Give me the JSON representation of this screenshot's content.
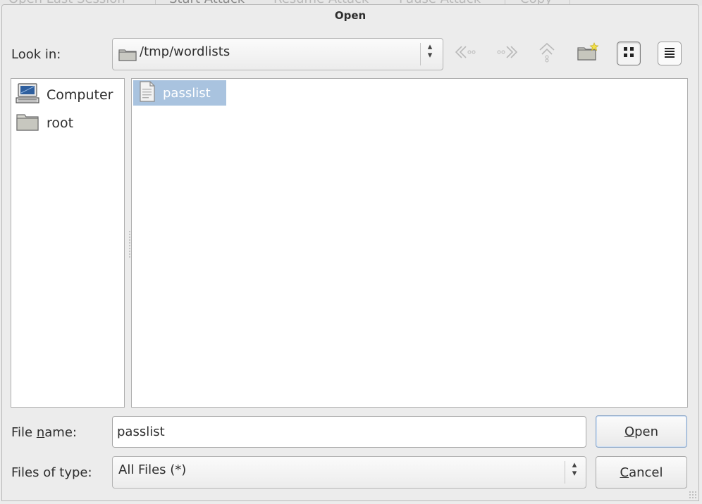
{
  "background_toolbar": {
    "items": [
      "Open Last Session",
      "Start Attack",
      "Resume Attack",
      "Pause Attack",
      "Copy"
    ]
  },
  "dialog": {
    "title": "Open",
    "look_in": {
      "label": "Look in:",
      "value": "/tmp/wordlists"
    },
    "toolbar": {
      "back_icon": "back-arrow-icon",
      "forward_icon": "forward-arrow-icon",
      "up_icon": "parent-directory-icon",
      "new_folder_icon": "new-folder-icon",
      "icon_view_icon": "icon-view-icon",
      "list_view_icon": "list-view-icon"
    },
    "places": [
      {
        "label": "Computer",
        "icon": "computer-icon"
      },
      {
        "label": "root",
        "icon": "folder-icon"
      }
    ],
    "files": [
      {
        "name": "passlist",
        "icon": "text-file-icon",
        "selected": true
      }
    ],
    "file_name": {
      "label_pre": "File ",
      "label_mnemonic": "n",
      "label_post": "ame:",
      "value": "passlist"
    },
    "file_type": {
      "label": "Files of type:",
      "value": "All Files (*)"
    },
    "buttons": {
      "open": {
        "mnemonic": "O",
        "rest": "pen"
      },
      "cancel": {
        "mnemonic": "C",
        "rest": "ancel"
      }
    },
    "colors": {
      "selection": "#a9c3df",
      "dialog_bg": "#ececec",
      "pane_bg": "#ffffff"
    }
  }
}
